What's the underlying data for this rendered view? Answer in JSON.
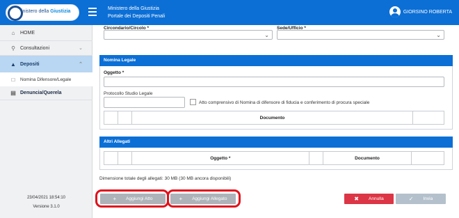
{
  "header": {
    "logo_text_a": "inistero della ",
    "logo_text_b": "Giustizia",
    "title_line1": "Ministero della Giustizia",
    "title_line2": "Portale dei Depositi Penali",
    "user_name": "GIORSINO ROBERTA",
    "accent_color": "#0b6fd6"
  },
  "sidebar": {
    "items": [
      {
        "label": "HOME",
        "icon": "home-icon"
      },
      {
        "label": "Consultazioni",
        "icon": "search-icon"
      },
      {
        "label": "Depositi",
        "icon": "graduation-cap-icon"
      },
      {
        "label": "Nomina Difensore/Legale",
        "icon": "document-icon"
      },
      {
        "label": "Denuncia/Querela",
        "icon": "document-icon"
      }
    ],
    "date": "23/04/2021 18:54:10",
    "version": "Versione 3.1.0"
  },
  "form": {
    "circondario_label": "Circondario/Circolo *",
    "sede_label": "Sede/Ufficio *",
    "nomina_title": "Nomina Legale",
    "oggetto_label": "Oggetto *",
    "protocollo_label": "Protocollo Studio Legale",
    "checkbox_label": "Atto comprensivo di Nomina di difensore di fiducia e conferimento di procura speciale",
    "documento_col": "Documento",
    "altri_title": "Altri Allegati",
    "oggetto_col": "Oggetto *",
    "documento_col2": "Documento",
    "dimension_text": "Dimensione totale degli allegati: 30 MB (30 MB ancora disponibili)"
  },
  "buttons": {
    "aggiungi_atto": "Aggiungi Atto",
    "aggiungi_allegato": "Aggiungi Allegato",
    "annulla": "Annulla",
    "invia": "Invia"
  }
}
